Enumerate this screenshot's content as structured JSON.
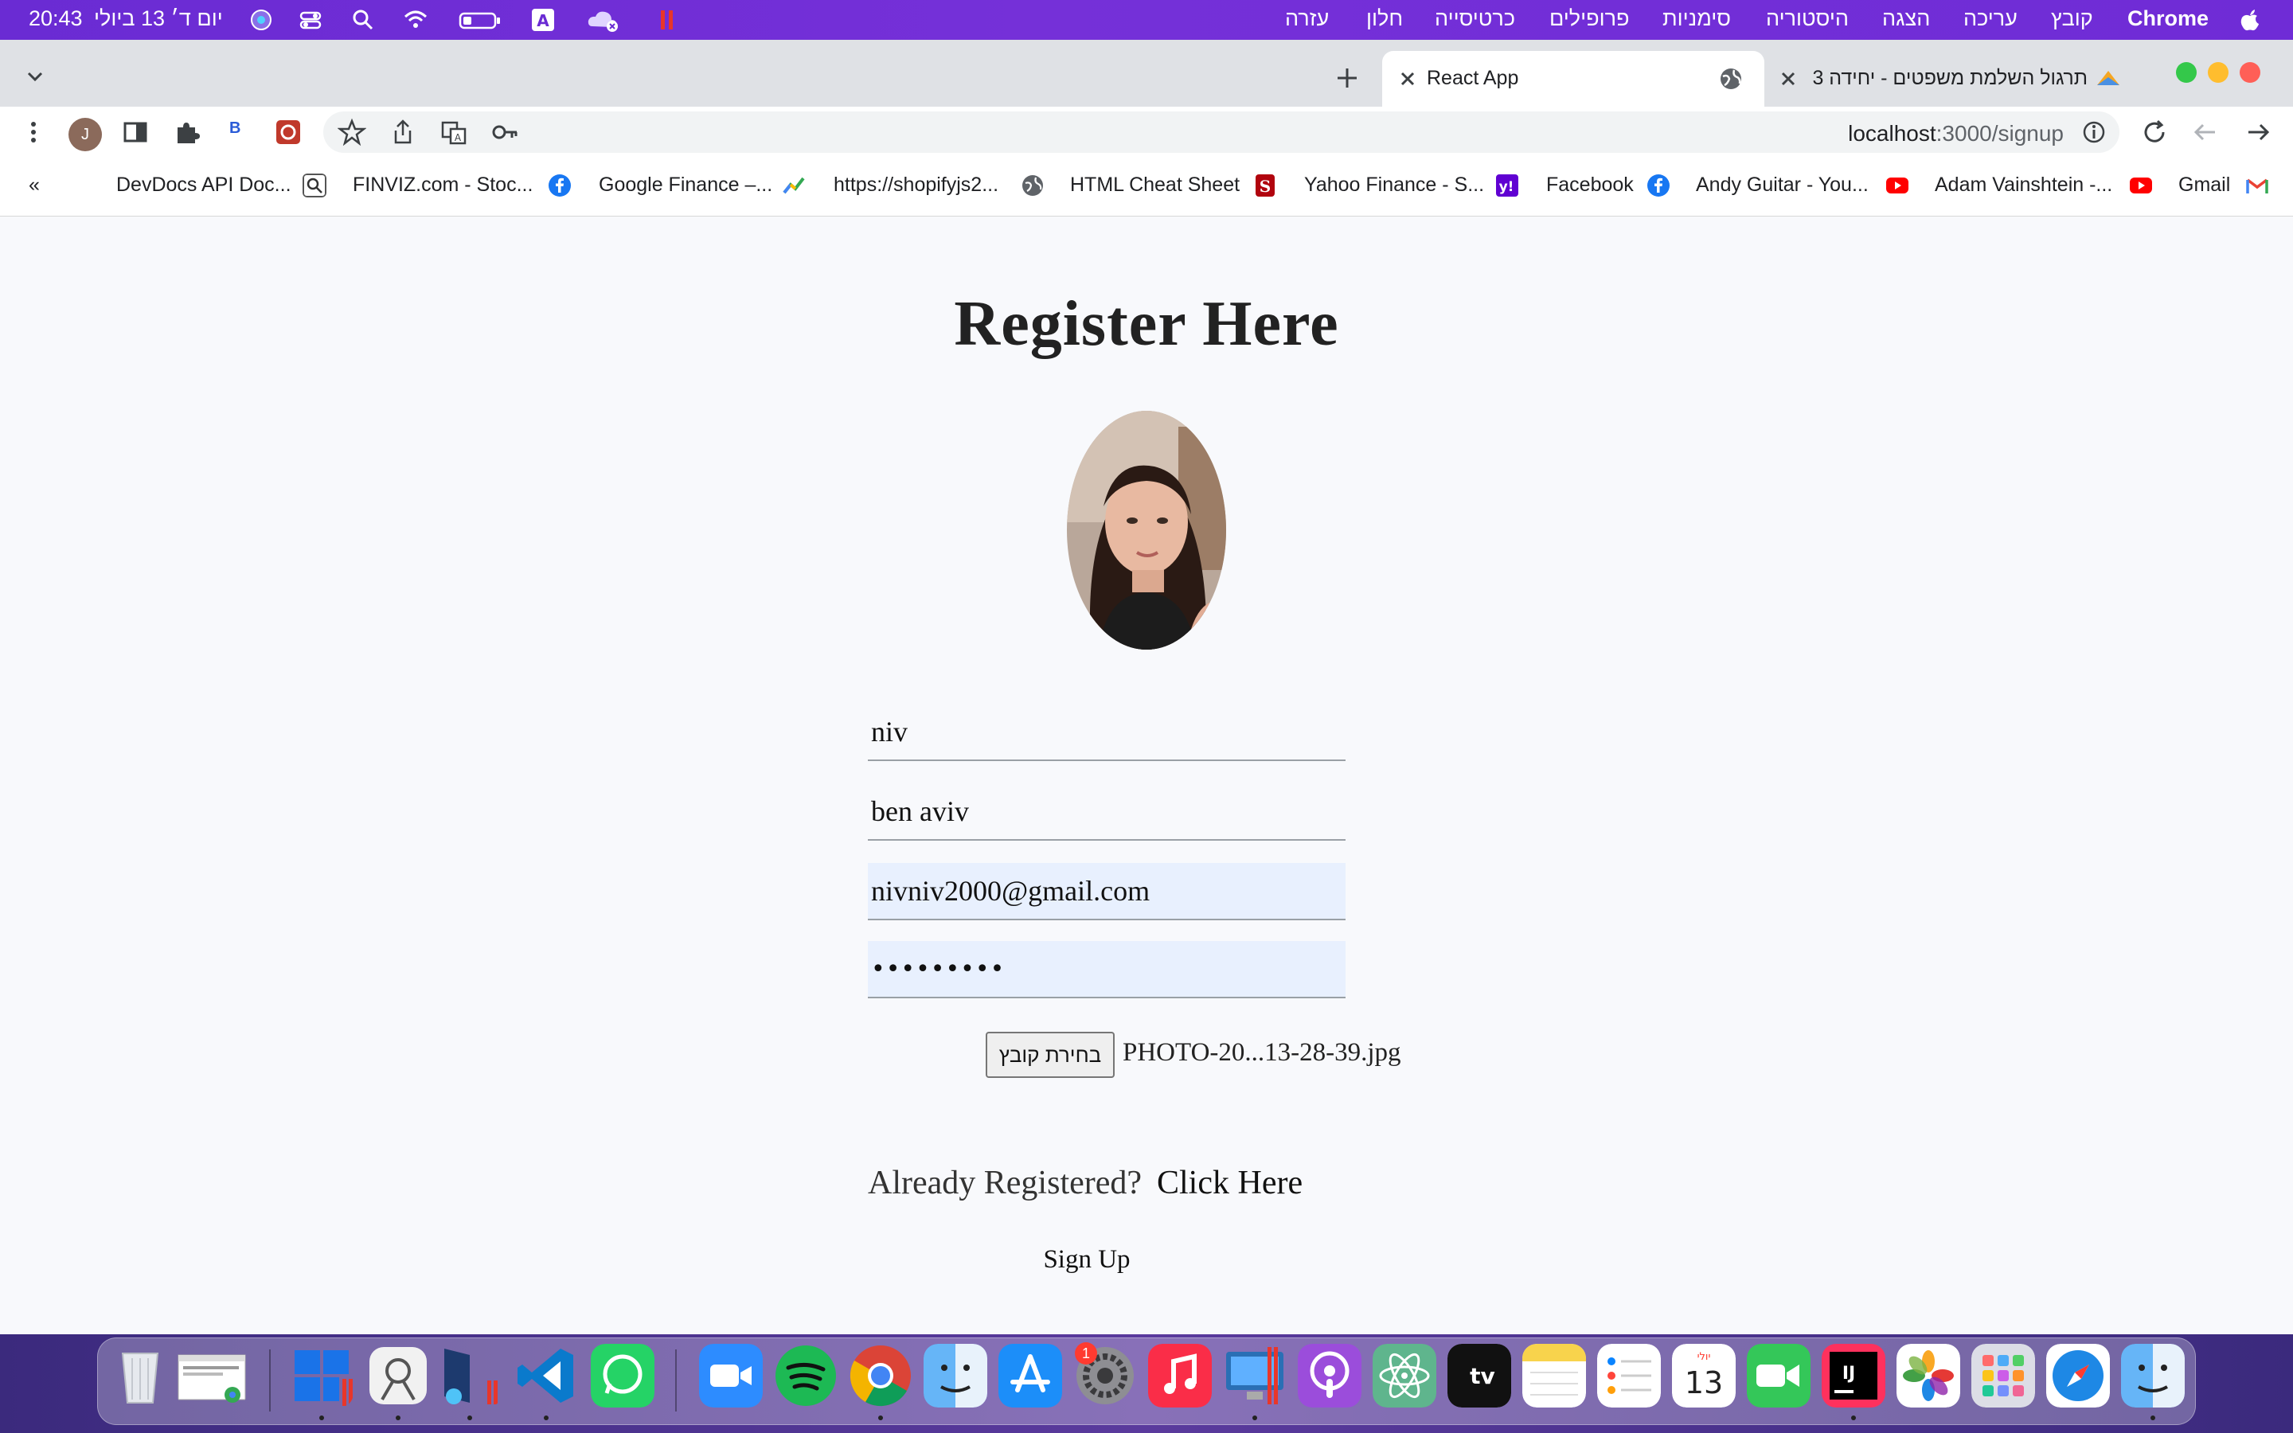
{
  "menubar": {
    "app_name": "Chrome",
    "menus": [
      "קובץ",
      "עריכה",
      "הצגה",
      "היסטוריה",
      "סימניות",
      "פרופילים",
      "כרטיסייה",
      "חלון",
      "עזרה"
    ],
    "clock": "20:43",
    "date": "יום ד׳ 13 ביולי"
  },
  "tabs": {
    "active_title": "React App",
    "other_title": "תרגול השלמת משפטים - יחידה 3"
  },
  "toolbar": {
    "url_host": "localhost",
    "url_path": ":3000/signup",
    "profile_initial": "J",
    "ext_letter": "B"
  },
  "bookmarks": {
    "overflow": "«",
    "items": [
      {
        "label": "DevDocs API Doc..."
      },
      {
        "label": "FINVIZ.com - Stoc..."
      },
      {
        "label": "Google Finance –..."
      },
      {
        "label": "https://shopifyjs2..."
      },
      {
        "label": "HTML Cheat Sheet"
      },
      {
        "label": "Yahoo Finance - S..."
      },
      {
        "label": "Facebook"
      },
      {
        "label": "Andy Guitar - You..."
      },
      {
        "label": "Adam Vainshtein -..."
      },
      {
        "label": "Gmail"
      }
    ]
  },
  "page": {
    "title": "Register Here",
    "fields": {
      "first_name": "niv",
      "last_name": "ben aviv",
      "email": "nivniv2000@gmail.com",
      "password": "•••••••••"
    },
    "file_button": "בחירת קובץ",
    "file_name": "PHOTO-20...13-28-39.jpg",
    "already_registered": "Already Registered?",
    "click_here": "Click Here",
    "sign_up": "Sign Up"
  },
  "dock": {
    "calendar_month": "יולי",
    "calendar_day": "13",
    "settings_badge": "1",
    "intellij_label": "IJ",
    "tv_label": "tv"
  }
}
